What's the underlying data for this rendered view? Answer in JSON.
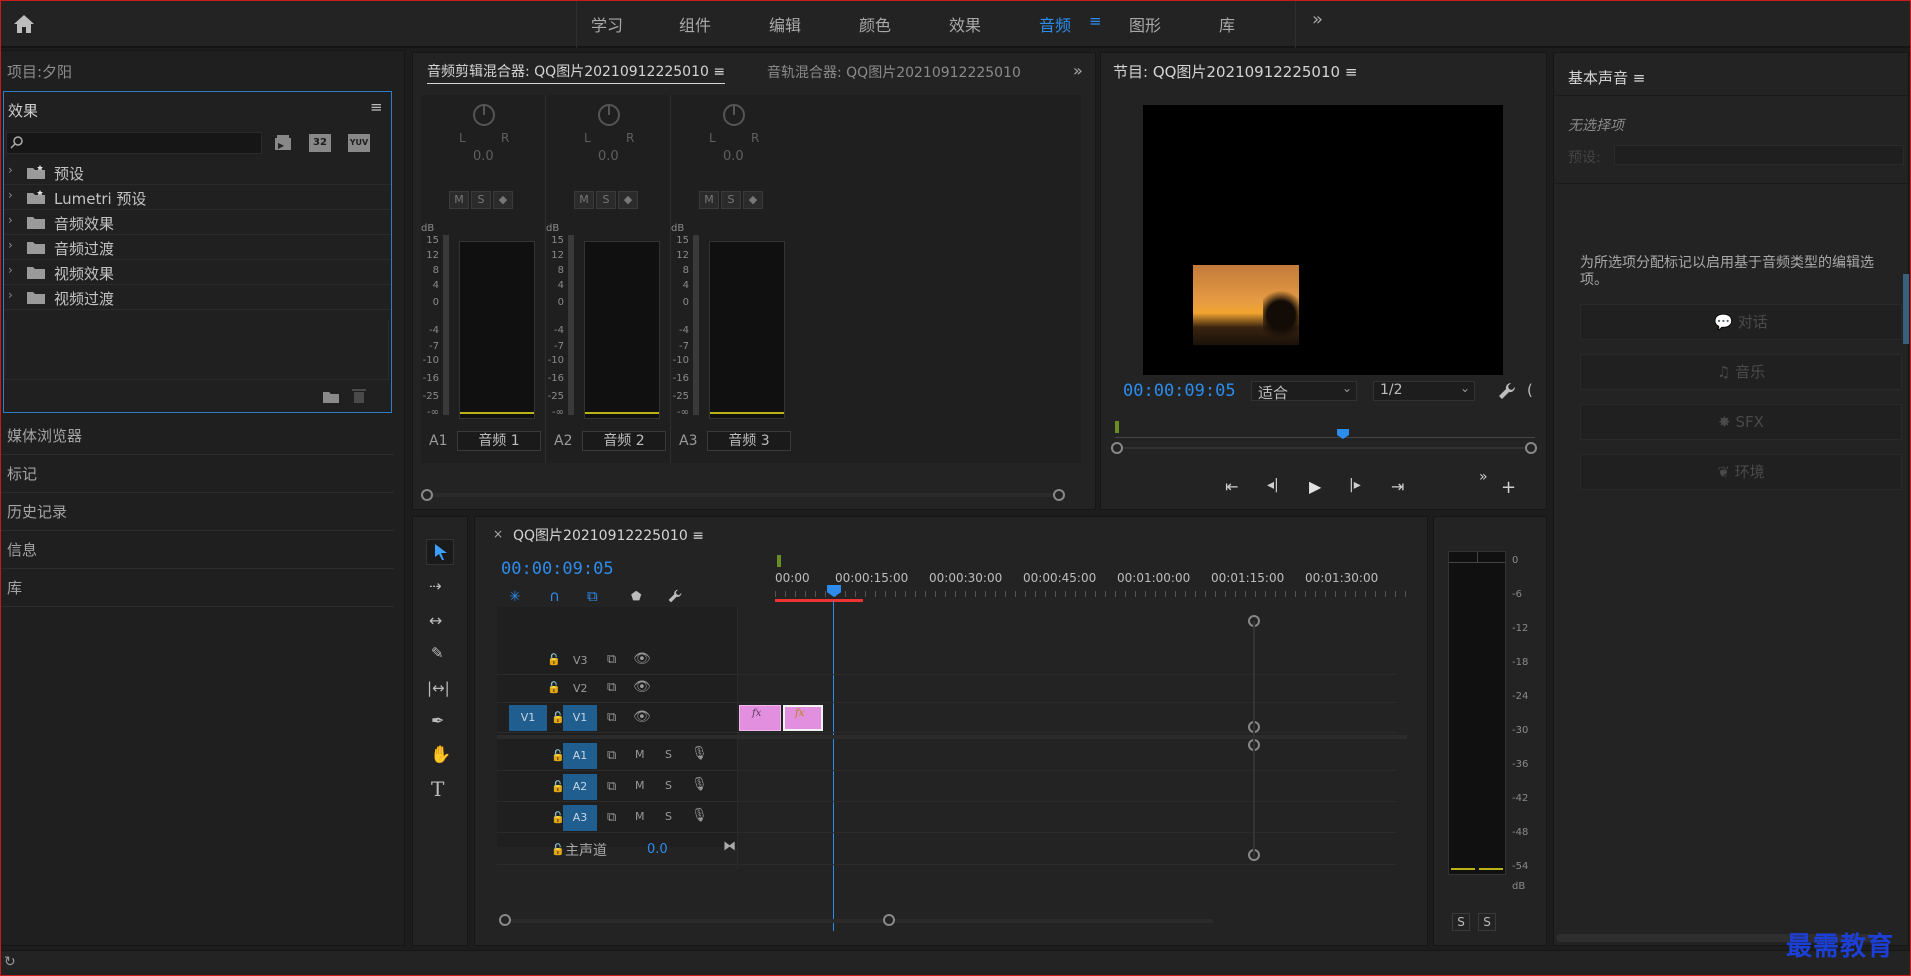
{
  "topbar": {
    "workspaces": [
      "学习",
      "组件",
      "编辑",
      "颜色",
      "效果",
      "音频",
      "图形",
      "库"
    ],
    "active_workspace": "音频",
    "more": "»"
  },
  "left": {
    "project_title": "项目:夕阳",
    "effects_title": "效果",
    "search_placeholder": "",
    "tree": [
      "预设",
      "Lumetri 预设",
      "音频效果",
      "音频过渡",
      "视频效果",
      "视频过渡"
    ],
    "collapsed_panels": [
      "媒体浏览器",
      "标记",
      "历史记录",
      "信息",
      "库"
    ],
    "icon_labels": {
      "btn32": "32",
      "yuv": "YUV"
    }
  },
  "mixer": {
    "tab_active": "音频剪辑混合器: QQ图片20210912225010",
    "tab_inactive": "音轨混合器: QQ图片20210912225010",
    "channels": [
      {
        "id": "A1",
        "name": "音频 1",
        "value": "0.0"
      },
      {
        "id": "A2",
        "name": "音频 2",
        "value": "0.0"
      },
      {
        "id": "A3",
        "name": "音频 3",
        "value": "0.0"
      }
    ],
    "db_label": "dB",
    "db_ticks": [
      "15",
      "12",
      "8",
      "4",
      "0",
      "-4",
      "-7",
      "-10",
      "-16",
      "-25",
      "-∞"
    ],
    "lr": "L",
    "lr2": "R",
    "msv": [
      "M",
      "S",
      "◆"
    ]
  },
  "program": {
    "title": "节目: QQ图片20210912225010",
    "timecode": "00:00:09:05",
    "fit": "适合",
    "resolution": "1/2"
  },
  "timeline": {
    "title": "QQ图片20210912225010",
    "timecode": "00:00:09:05",
    "ruler": [
      "00:00",
      "00:00:15:00",
      "00:00:30:00",
      "00:00:45:00",
      "00:01:00:00",
      "00:01:15:00",
      "00:01:30:00"
    ],
    "video_tracks": [
      "V3",
      "V2",
      "V1"
    ],
    "audio_tracks": [
      "A1",
      "A2",
      "A3"
    ],
    "source_v1": "V1",
    "master_label": "主声道",
    "master_value": "0.0",
    "m": "M",
    "s": "S",
    "fx": "fx"
  },
  "meter": {
    "ticks": [
      "0",
      "-6",
      "-12",
      "-18",
      "-24",
      "-30",
      "-36",
      "-42",
      "-48",
      "-54",
      "dB"
    ],
    "solo": [
      "S",
      "S"
    ]
  },
  "essential_sound": {
    "title": "基本声音",
    "no_selection": "无选择项",
    "preset_label": "预设:",
    "hint": "为所选项分配标记以启用基于音频类型的编辑选项。",
    "buttons": [
      "对话",
      "音乐",
      "SFX",
      "环境"
    ]
  },
  "watermark": "最需教育",
  "colors": {
    "accent": "#2d8ceb",
    "clip": "#e38fe0",
    "meter_line": "#b9b315",
    "playhead_red": "#e33"
  }
}
